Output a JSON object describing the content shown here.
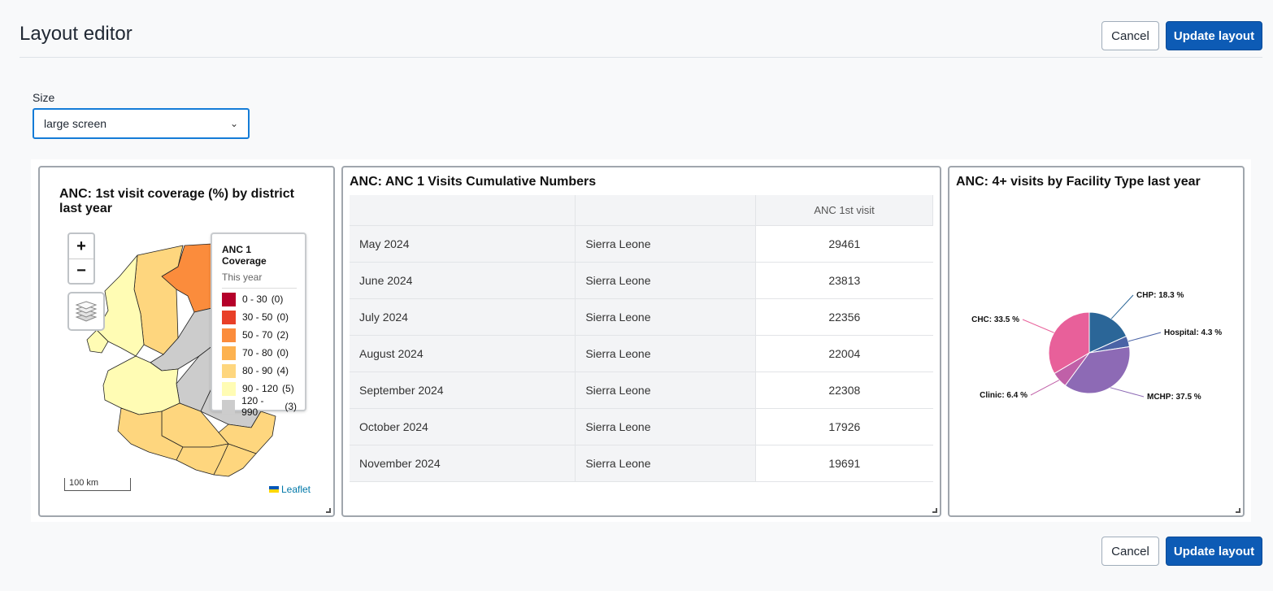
{
  "header": {
    "title": "Layout editor",
    "cancel_label": "Cancel",
    "update_label": "Update layout"
  },
  "size": {
    "label": "Size",
    "selected": "large screen"
  },
  "map_card": {
    "title": "ANC: 1st visit coverage (%) by district last year",
    "zoom_in": "+",
    "zoom_out": "−",
    "legend": {
      "title": "ANC 1 Coverage",
      "subtitle": "This year",
      "items": [
        {
          "range": "0 - 30",
          "count": "(0)",
          "color": "#b5002a"
        },
        {
          "range": "30 - 50",
          "count": "(0)",
          "color": "#e83f27"
        },
        {
          "range": "50 - 70",
          "count": "(2)",
          "color": "#fb8c3c"
        },
        {
          "range": "70 - 80",
          "count": "(0)",
          "color": "#fdb24f"
        },
        {
          "range": "80 - 90",
          "count": "(4)",
          "color": "#fed67e"
        },
        {
          "range": "90 - 120",
          "count": "(5)",
          "color": "#fffcb4"
        },
        {
          "range": "120 - 990",
          "count": "(3)",
          "color": "#cccccc"
        }
      ]
    },
    "scale": "100 km",
    "attribution": "Leaflet"
  },
  "table_card": {
    "title": "ANC: ANC 1 Visits Cumulative Numbers",
    "column_header": "ANC 1st visit",
    "rows": [
      {
        "period": "May 2024",
        "org": "Sierra Leone",
        "value": "29461"
      },
      {
        "period": "June 2024",
        "org": "Sierra Leone",
        "value": "23813"
      },
      {
        "period": "July 2024",
        "org": "Sierra Leone",
        "value": "22356"
      },
      {
        "period": "August 2024",
        "org": "Sierra Leone",
        "value": "22004"
      },
      {
        "period": "September 2024",
        "org": "Sierra Leone",
        "value": "22308"
      },
      {
        "period": "October 2024",
        "org": "Sierra Leone",
        "value": "17926"
      },
      {
        "period": "November 2024",
        "org": "Sierra Leone",
        "value": "19691"
      }
    ]
  },
  "pie_card": {
    "title": "ANC: 4+ visits by Facility Type last year"
  },
  "chart_data": {
    "type": "pie",
    "title": "ANC: 4+ visits by Facility Type last year",
    "slices": [
      {
        "name": "CHP",
        "value": 18.3,
        "label": "CHP: 18.3 %",
        "color": "#2b6698"
      },
      {
        "name": "Hospital",
        "value": 4.3,
        "label": "Hospital: 4.3 %",
        "color": "#4a63a6"
      },
      {
        "name": "MCHP",
        "value": 37.5,
        "label": "MCHP: 37.5 %",
        "color": "#8d6ab5"
      },
      {
        "name": "Clinic",
        "value": 6.4,
        "label": "Clinic: 6.4 %",
        "color": "#c060a8"
      },
      {
        "name": "CHC",
        "value": 33.5,
        "label": "CHC: 33.5 %",
        "color": "#e8609a"
      }
    ]
  },
  "footer": {
    "cancel_label": "Cancel",
    "update_label": "Update layout"
  }
}
